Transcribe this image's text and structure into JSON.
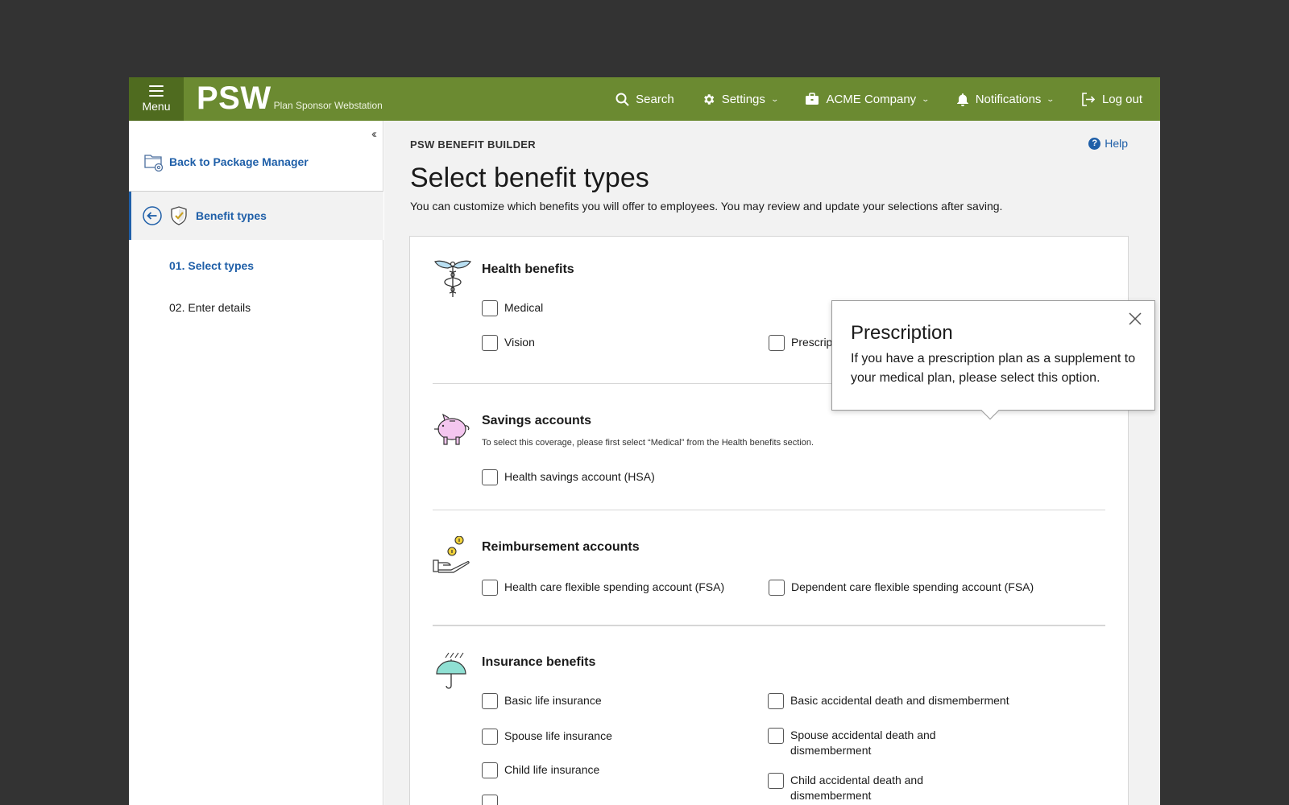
{
  "topbar": {
    "menu_label": "Menu",
    "logo_main": "PSW",
    "logo_sub": "Plan Sponsor Webstation",
    "search_label": "Search",
    "settings_label": "Settings",
    "company_label": "ACME Company",
    "notifications_label": "Notifications",
    "logout_label": "Log out"
  },
  "sidebar": {
    "collapse": "‹‹",
    "back_label": "Back to Package Manager",
    "active_label": "Benefit types",
    "steps": [
      "01. Select types",
      "02. Enter details"
    ]
  },
  "main": {
    "eyebrow": "PSW BENEFIT BUILDER",
    "help_label": "Help",
    "title": "Select benefit types",
    "description": "You can customize which benefits you will offer to employees. You may review and update your selections after saving."
  },
  "sections": {
    "health": {
      "title": "Health benefits",
      "options": [
        "Medical",
        "Vision",
        "Prescription"
      ]
    },
    "savings": {
      "title": "Savings accounts",
      "note": "To select this coverage, please first select “Medical” from the Health benefits section.",
      "options": [
        "Health savings account (HSA)"
      ]
    },
    "reimbursement": {
      "title": "Reimbursement accounts",
      "options": [
        "Health care flexible spending account (FSA)",
        "Dependent care flexible spending account (FSA)"
      ]
    },
    "insurance": {
      "title": "Insurance benefits",
      "options": [
        "Basic life insurance",
        "Basic accidental death and dismemberment",
        "Spouse life insurance",
        "Spouse accidental death and dismemberment",
        "Child life insurance",
        "Child accidental death and dismemberment"
      ]
    }
  },
  "popover": {
    "title": "Prescription",
    "body": "If you have a prescription plan as a supplement to your medical plan, please select this option."
  },
  "colors": {
    "topbar": "#6b8a31",
    "menu_bg": "#4f6b1f",
    "link_blue": "#1f5fa8",
    "page_bg": "#333333"
  }
}
